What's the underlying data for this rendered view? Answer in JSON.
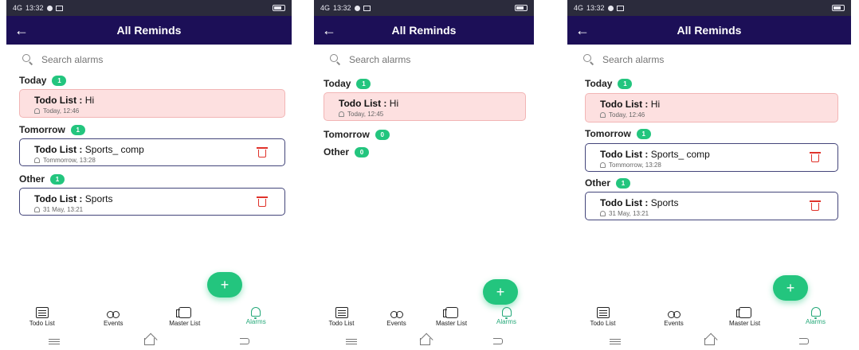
{
  "screens": [
    {
      "status": {
        "time": "13:32",
        "signal": "4G",
        "battery": ""
      },
      "appbar": {
        "back": "←",
        "title": "All Reminds"
      },
      "search": {
        "placeholder": "Search alarms"
      },
      "today": {
        "label": "Today",
        "count": "1"
      },
      "today_card": {
        "prefix": "Todo List :",
        "text": "Hi",
        "time": "Today, 12:46"
      },
      "tomorrow": {
        "label": "Tomorrow",
        "count": "1"
      },
      "tomorrow_card": {
        "prefix": "Todo List :",
        "text": "Sports_ comp",
        "time": "Tommorrow, 13:28"
      },
      "other": {
        "label": "Other",
        "count": "1"
      },
      "other_card": {
        "prefix": "Todo List :",
        "text": "Sports",
        "time": "31 May, 13:21"
      },
      "fab": "+",
      "nav": [
        "Todo List",
        "Events",
        "Master List",
        "Alarms"
      ]
    },
    {
      "status": {
        "time": "13:32",
        "signal": "4G",
        "battery": ""
      },
      "appbar": {
        "back": "←",
        "title": "All Reminds"
      },
      "search": {
        "placeholder": "Search alarms"
      },
      "today": {
        "label": "Today",
        "count": "1"
      },
      "today_card": {
        "prefix": "Todo List :",
        "text": "Hi",
        "time": "Today, 12:45"
      },
      "tomorrow": {
        "label": "Tomorrow",
        "count": "0"
      },
      "other": {
        "label": "Other",
        "count": "0"
      },
      "fab": "+",
      "nav": [
        "Todo List",
        "Events",
        "Master List",
        "Alarms"
      ]
    },
    {
      "status": {
        "time": "13:32",
        "signal": "4G",
        "battery": ""
      },
      "appbar": {
        "back": "←",
        "title": "All Reminds"
      },
      "search": {
        "placeholder": "Search alarms"
      },
      "today": {
        "label": "Today",
        "count": "1"
      },
      "today_card": {
        "prefix": "Todo List :",
        "text": "Hi",
        "time": "Today, 12:46"
      },
      "tomorrow": {
        "label": "Tomorrow",
        "count": "1"
      },
      "tomorrow_card": {
        "prefix": "Todo List :",
        "text": "Sports_ comp",
        "time": "Tommorrow, 13:28"
      },
      "other": {
        "label": "Other",
        "count": "1"
      },
      "other_card": {
        "prefix": "Todo List :",
        "text": "Sports",
        "time": "31 May, 13:21"
      },
      "fab": "+",
      "nav": [
        "Todo List",
        "Events",
        "Master List",
        "Alarms"
      ]
    }
  ],
  "colors": {
    "appbar": "#1c0f57",
    "accent": "#23c57e",
    "today_card": "#fde0e0",
    "delete": "#e0322a",
    "card_border": "#43457a"
  },
  "icons": {
    "back": "arrow-left-icon",
    "search": "search-icon",
    "reminder": "bell-icon",
    "delete": "trash-icon",
    "fab": "plus-icon"
  }
}
